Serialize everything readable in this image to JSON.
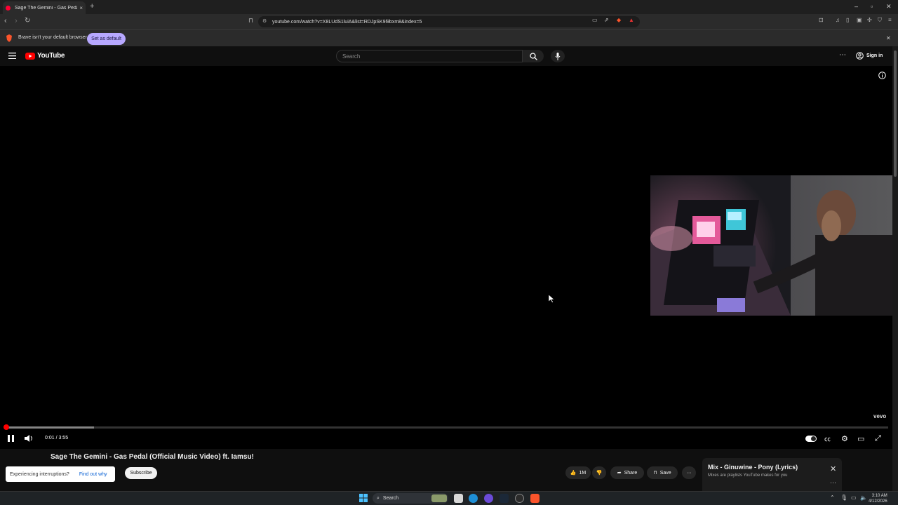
{
  "browser": {
    "tab_title": "Sage The Gemini - Gas Pedal (O",
    "tab_close": "×",
    "new_tab": "+",
    "window_controls": [
      "–",
      "▫",
      "✕"
    ],
    "url": "youtube.com/watch?v=X8LUdS1luiA&list=RDJpSK9l9bxm8&index=5",
    "infobar_text": "Brave isn't your default browser",
    "infobar_button": "Set as default",
    "infobar_close": "✕"
  },
  "youtube": {
    "logo_text": "YouTube",
    "search_placeholder": "Search",
    "sign_in": "Sign in",
    "more": "⋯"
  },
  "player": {
    "time": "0:01 / 3:55",
    "progress_played_fraction": 0.0008,
    "progress_buffered_fraction": 0.1,
    "watermark": "vevo"
  },
  "video_info": {
    "title": "Sage The Gemini - Gas Pedal (Official Music Video) ft. Iamsu!",
    "interrupt_text": "Experiencing interruptions?",
    "interrupt_link": "Find out why",
    "subscribe": "Subscribe",
    "like_count": "1M",
    "share": "Share",
    "save": "Save",
    "more": "···"
  },
  "mix_panel": {
    "title": "Mix - Ginuwine - Pony (Lyrics)",
    "subtitle": "Mixes are playlists YouTube makes for you",
    "close": "✕",
    "more": "···"
  },
  "taskbar": {
    "search": "Search",
    "time": "3:10 AM",
    "date": "4/12/2026"
  },
  "colors": {
    "accent_red": "#ff0000",
    "set_default_bg": "#b7a8ff"
  }
}
